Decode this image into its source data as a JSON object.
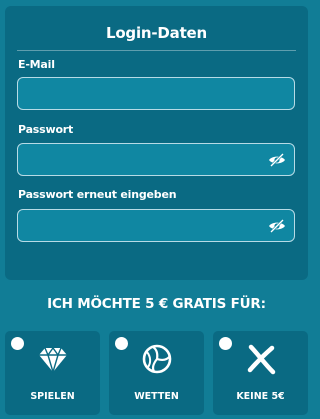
{
  "login": {
    "title": "Login-Daten",
    "email_label": "E-Mail",
    "email_value": "",
    "password_label": "Passwort",
    "password_value": "",
    "password_repeat_label": "Passwort erneut eingeben",
    "password_repeat_value": ""
  },
  "bonus": {
    "heading": "ICH MÖCHTE 5 € GRATIS FÜR:",
    "options": [
      {
        "label": "SPIELEN",
        "icon": "diamond-icon"
      },
      {
        "label": "WETTEN",
        "icon": "volleyball-icon"
      },
      {
        "label": "KEINE 5€",
        "icon": "cross-icon"
      }
    ]
  },
  "colors": {
    "page_bg": "#117d96",
    "card_bg": "#0a6a83",
    "field_bg": "#1087a2",
    "field_border": "#b7dbe6",
    "text": "#ffffff"
  }
}
